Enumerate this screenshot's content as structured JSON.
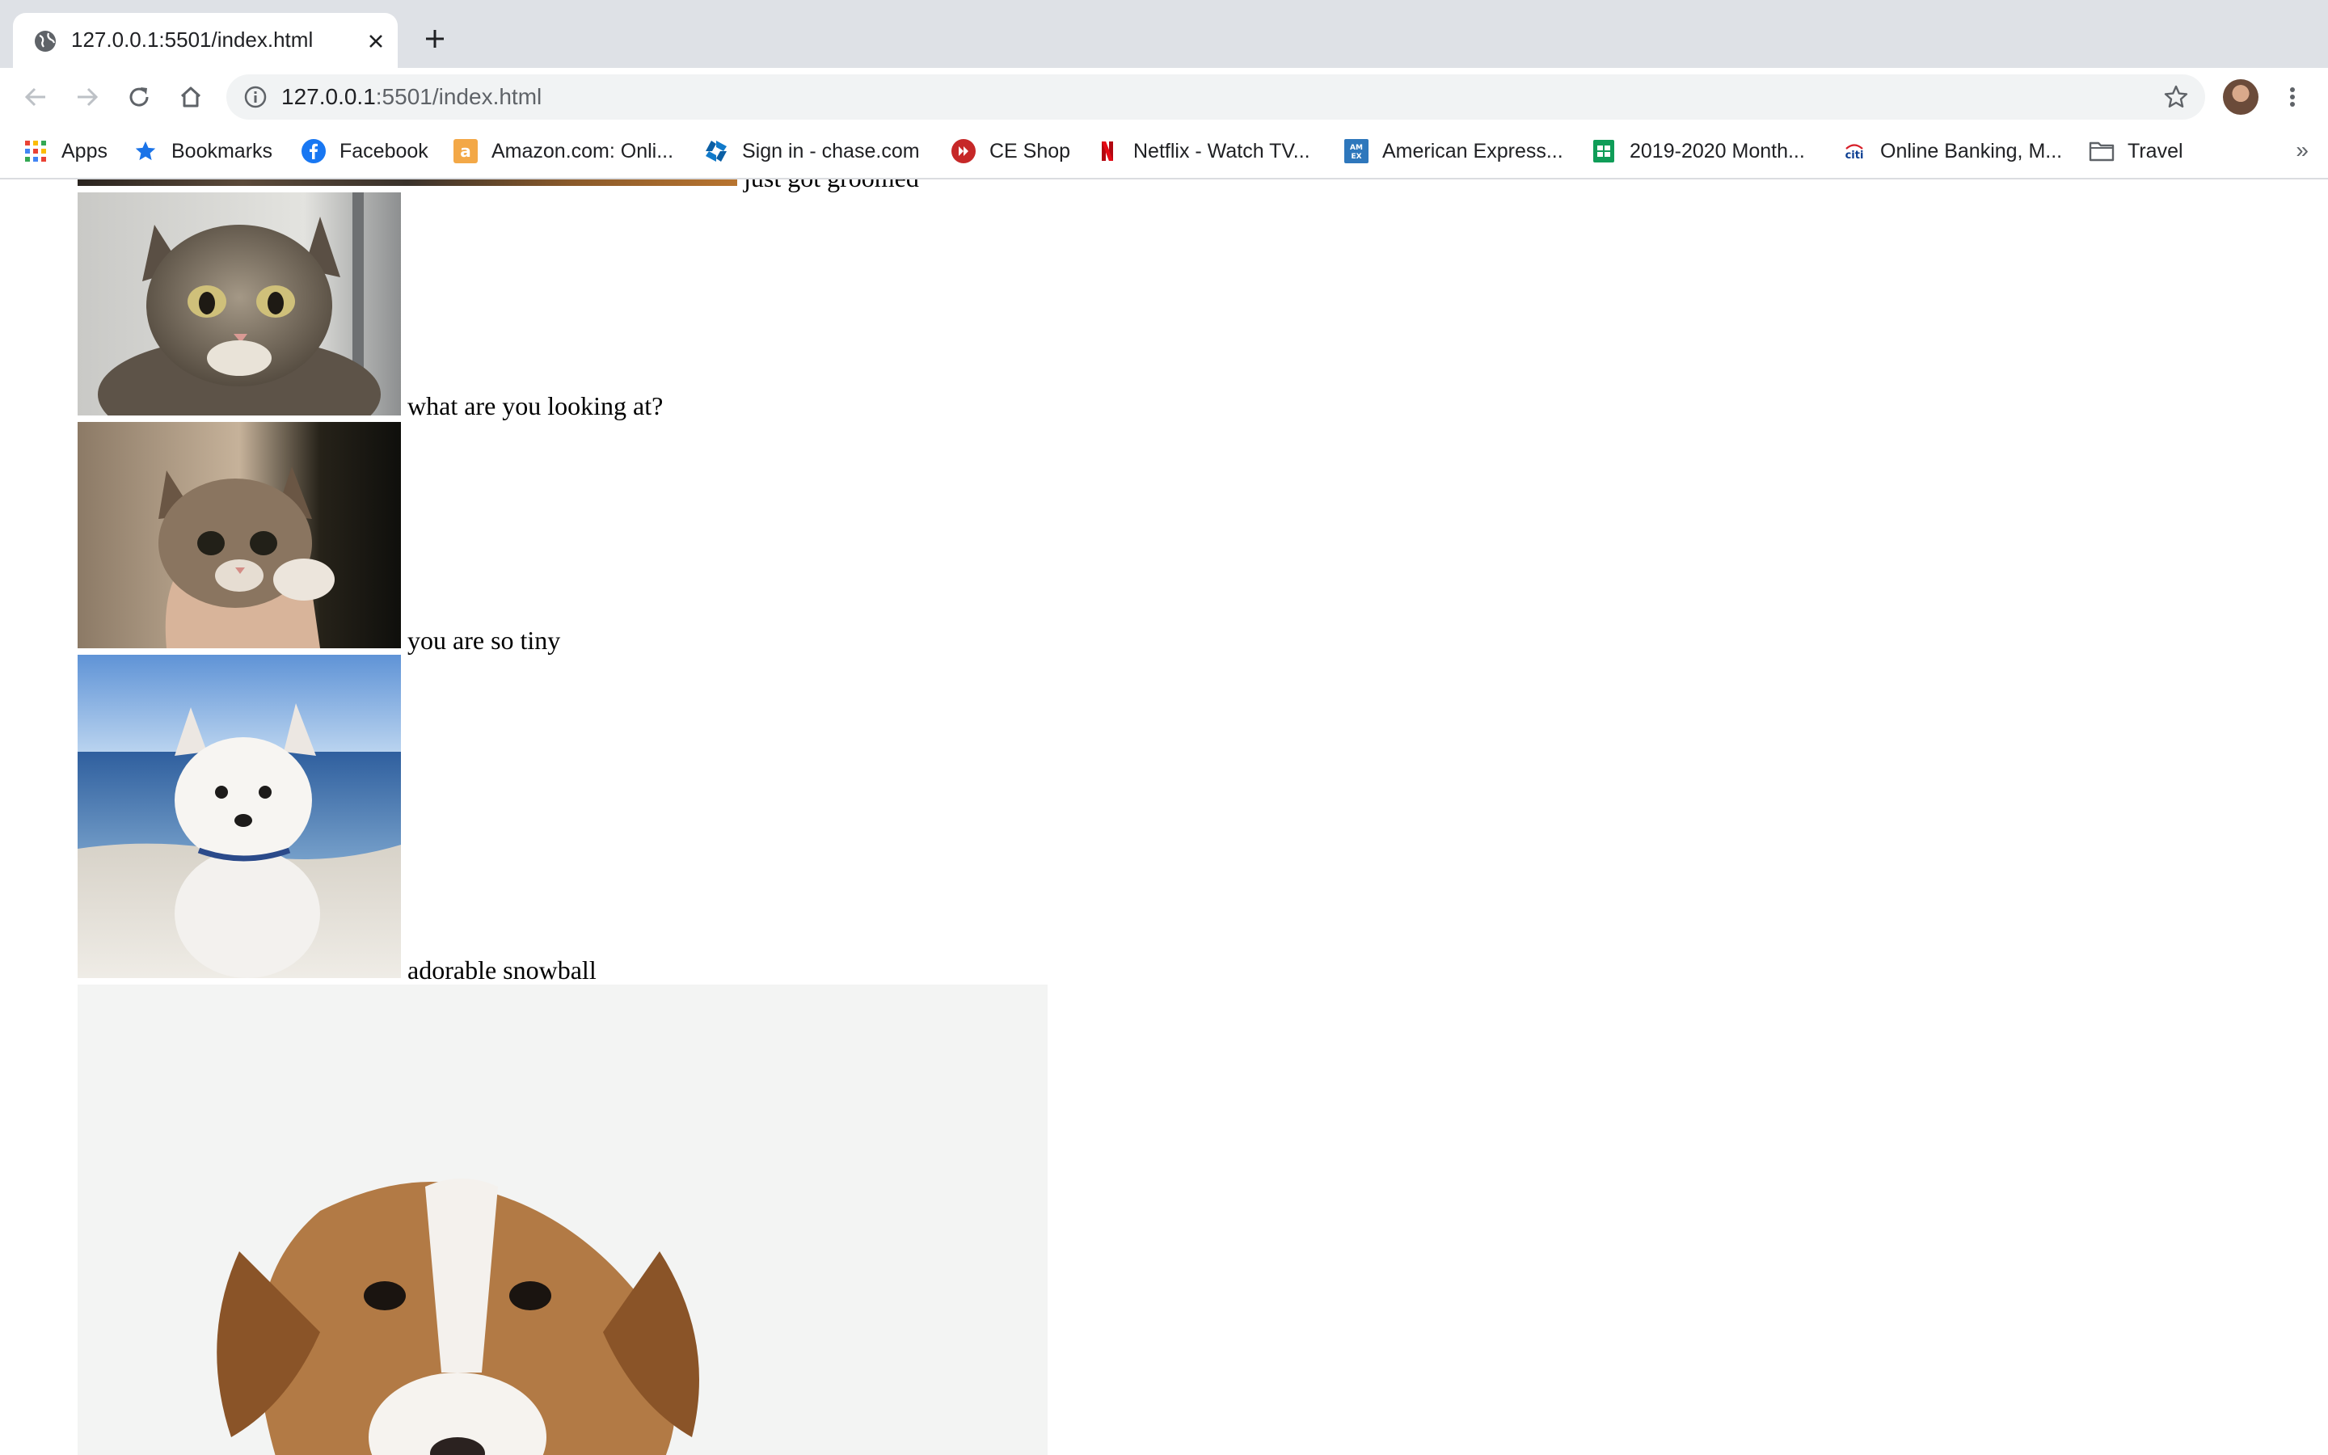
{
  "browser": {
    "tab": {
      "title": "127.0.0.1:5501/index.html"
    },
    "address_bar": {
      "host": "127.0.0.1",
      "rest": ":5501/index.html"
    },
    "bookmarks": [
      {
        "label": "Apps",
        "icon": "apps-grid-icon"
      },
      {
        "label": "Bookmarks",
        "icon": "star-icon"
      },
      {
        "label": "Facebook",
        "icon": "facebook-icon"
      },
      {
        "label": "Amazon.com: Onli...",
        "icon": "amazon-icon"
      },
      {
        "label": "Sign in - chase.com",
        "icon": "chase-icon"
      },
      {
        "label": "CE Shop",
        "icon": "ce-shop-icon"
      },
      {
        "label": "Netflix - Watch TV...",
        "icon": "netflix-icon"
      },
      {
        "label": "American Express...",
        "icon": "amex-icon"
      },
      {
        "label": "2019-2020 Month...",
        "icon": "sheets-icon"
      },
      {
        "label": "Online Banking, M...",
        "icon": "citi-icon"
      },
      {
        "label": "Travel",
        "icon": "folder-icon"
      }
    ],
    "overflow_label": "»"
  },
  "page": {
    "entries": [
      {
        "caption": "just got groomed",
        "image": "dog photo (cut off at top)"
      },
      {
        "caption": "what are you looking at?",
        "image": "tabby kitten"
      },
      {
        "caption": "you are so tiny",
        "image": "small kitten held in hand"
      },
      {
        "caption": "adorable snowball",
        "image": "white puppy on beach"
      },
      {
        "caption": "",
        "image": "beagle puppy"
      }
    ]
  },
  "colors": {
    "tabstrip_bg": "#dee1e6",
    "omnibox_bg": "#f1f3f4",
    "text": "#202124",
    "muted": "#5f6368",
    "page_bg": "#ffffff"
  }
}
